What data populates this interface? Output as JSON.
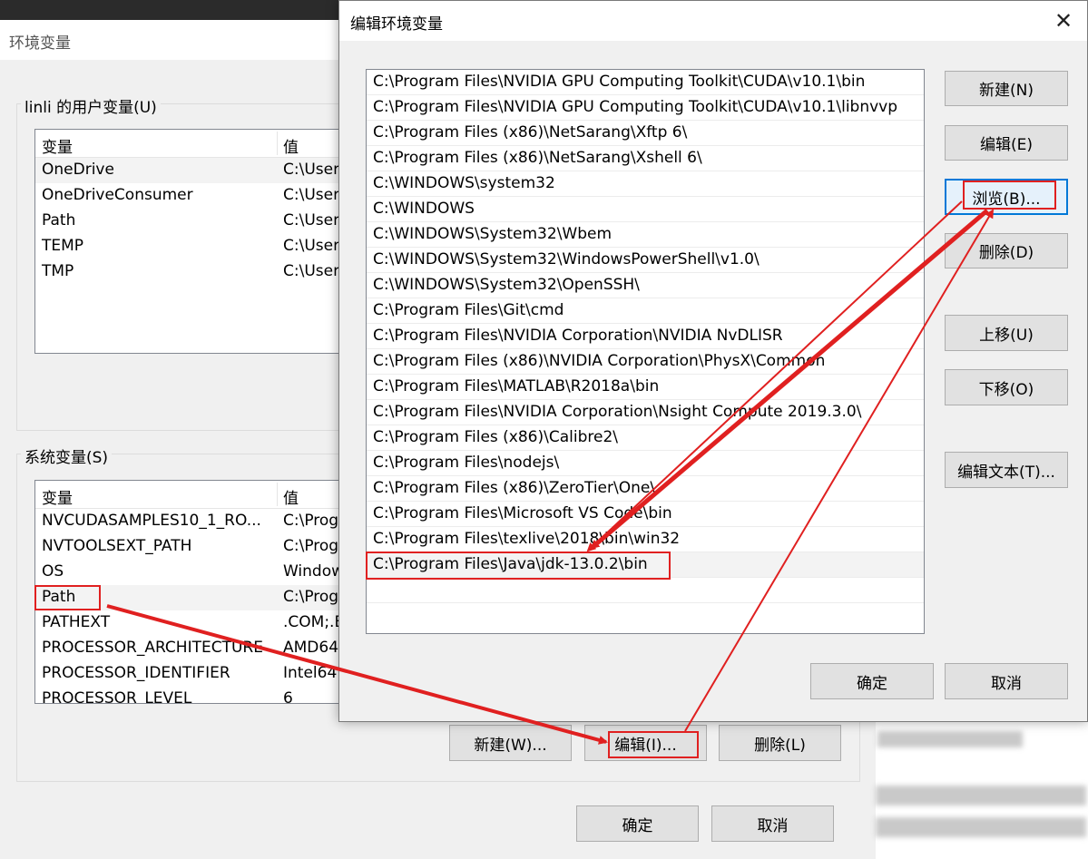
{
  "env_window": {
    "title": "环境变量",
    "user_group_label": "linli 的用户变量(U)",
    "system_group_label": "系统变量(S)",
    "col_variable": "变量",
    "col_value": "值",
    "user_vars": [
      {
        "name": "OneDrive",
        "value": "C:\\User"
      },
      {
        "name": "OneDriveConsumer",
        "value": "C:\\User"
      },
      {
        "name": "Path",
        "value": "C:\\User"
      },
      {
        "name": "TEMP",
        "value": "C:\\User"
      },
      {
        "name": "TMP",
        "value": "C:\\User"
      }
    ],
    "system_vars": [
      {
        "name": "NVCUDASAMPLES10_1_RO...",
        "value": "C:\\Prog"
      },
      {
        "name": "NVTOOLSEXT_PATH",
        "value": "C:\\Prog"
      },
      {
        "name": "OS",
        "value": "Window"
      },
      {
        "name": "Path",
        "value": "C:\\Prog"
      },
      {
        "name": "PATHEXT",
        "value": ".COM;.E"
      },
      {
        "name": "PROCESSOR_ARCHITECTURE",
        "value": "AMD64"
      },
      {
        "name": "PROCESSOR_IDENTIFIER",
        "value": "Intel64"
      },
      {
        "name": "PROCESSOR_LEVEL",
        "value": "6"
      }
    ],
    "new_button": "新建(W)...",
    "edit_button": "编辑(I)...",
    "delete_button": "删除(L)",
    "ok_button": "确定",
    "cancel_button": "取消"
  },
  "dialog": {
    "title": "编辑环境变量",
    "close_icon": "✕",
    "paths": [
      "C:\\Program Files\\NVIDIA GPU Computing Toolkit\\CUDA\\v10.1\\bin",
      "C:\\Program Files\\NVIDIA GPU Computing Toolkit\\CUDA\\v10.1\\libnvvp",
      "C:\\Program Files (x86)\\NetSarang\\Xftp 6\\",
      "C:\\Program Files (x86)\\NetSarang\\Xshell 6\\",
      "C:\\WINDOWS\\system32",
      "C:\\WINDOWS",
      "C:\\WINDOWS\\System32\\Wbem",
      "C:\\WINDOWS\\System32\\WindowsPowerShell\\v1.0\\",
      "C:\\WINDOWS\\System32\\OpenSSH\\",
      "C:\\Program Files\\Git\\cmd",
      "C:\\Program Files\\NVIDIA Corporation\\NVIDIA NvDLISR",
      "C:\\Program Files (x86)\\NVIDIA Corporation\\PhysX\\Common",
      "C:\\Program Files\\MATLAB\\R2018a\\bin",
      "C:\\Program Files\\NVIDIA Corporation\\Nsight Compute 2019.3.0\\",
      "C:\\Program Files (x86)\\Calibre2\\",
      "C:\\Program Files\\nodejs\\",
      "C:\\Program Files (x86)\\ZeroTier\\One\\",
      "C:\\Program Files\\Microsoft VS Code\\bin",
      "C:\\Program Files\\texlive\\2018\\bin\\win32",
      "C:\\Program Files\\Java\\jdk-13.0.2\\bin"
    ],
    "buttons": {
      "new": "新建(N)",
      "edit": "编辑(E)",
      "browse": "浏览(B)...",
      "delete": "删除(D)",
      "move_up": "上移(U)",
      "move_down": "下移(O)",
      "edit_text": "编辑文本(T)...",
      "ok": "确定",
      "cancel": "取消"
    }
  },
  "annotation_color": "#e02020"
}
